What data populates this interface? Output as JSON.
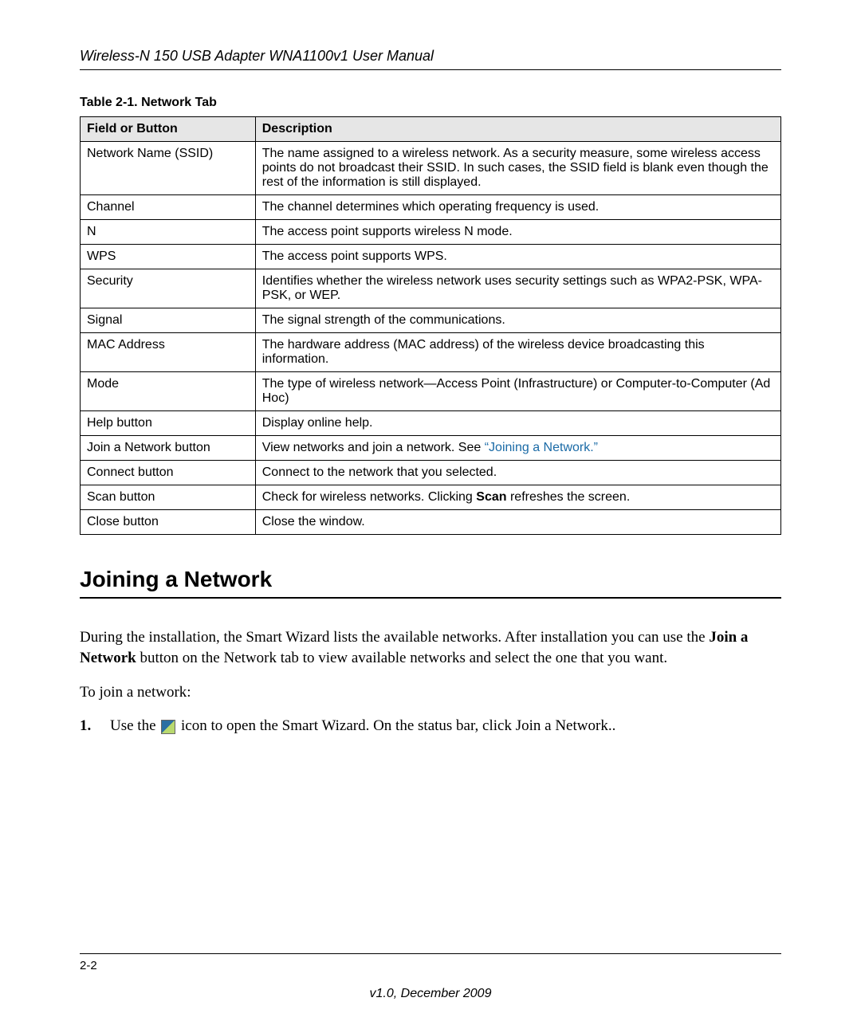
{
  "header": {
    "title": "Wireless-N 150 USB Adapter WNA1100v1 User Manual"
  },
  "table": {
    "caption": "Table 2-1.  Network Tab",
    "headers": {
      "field": "Field or Button",
      "desc": "Description"
    },
    "rows": [
      {
        "field": "Network Name (SSID)",
        "desc": "The name assigned to a wireless network. As a security measure, some wireless access points do not broadcast their SSID. In such cases, the SSID field is blank even though the rest of the information is still displayed."
      },
      {
        "field": "Channel",
        "desc": "The channel determines which operating frequency is used."
      },
      {
        "field": "N",
        "desc": "The access point supports wireless N mode."
      },
      {
        "field": "WPS",
        "desc": "The access point supports WPS."
      },
      {
        "field": "Security",
        "desc": "Identifies whether the wireless network uses security settings such as WPA2-PSK, WPA-PSK, or WEP."
      },
      {
        "field": "Signal",
        "desc": "The signal strength of the communications."
      },
      {
        "field": "MAC Address",
        "desc": "The hardware address (MAC address) of the wireless device broadcasting this information."
      },
      {
        "field": "Mode",
        "desc": "The type of wireless network—Access Point (Infrastructure) or Computer-to-Computer (Ad Hoc)"
      },
      {
        "field": "Help button",
        "desc": "Display online help."
      },
      {
        "field": "Join a Network button",
        "desc_prefix": "View networks and join a network. See ",
        "desc_link_quote_open": "“",
        "desc_link_text": "Joining a Network",
        "desc_link_quote_close": ".”"
      },
      {
        "field": "Connect button",
        "desc": "Connect to the network that you selected."
      },
      {
        "field": "Scan button",
        "desc_prefix": "Check for wireless networks. Clicking ",
        "desc_bold": "Scan",
        "desc_suffix": " refreshes the screen."
      },
      {
        "field": "Close button",
        "desc": "Close the window."
      }
    ]
  },
  "section": {
    "heading": "Joining a Network",
    "para1_pre": "During the installation, the Smart Wizard lists the available networks. After installation you can use the ",
    "para1_bold": "Join a Network",
    "para1_post": " button on the Network tab to view available networks and select the one that you want.",
    "para2": "To join a network:",
    "step1_num": "1.",
    "step1_pre": "Use the ",
    "step1_mid": " icon to open the Smart Wizard. On the status bar, click ",
    "step1_bold": "Join a Network",
    "step1_post": ".."
  },
  "footer": {
    "page": "2-2",
    "version": "v1.0, December 2009"
  }
}
